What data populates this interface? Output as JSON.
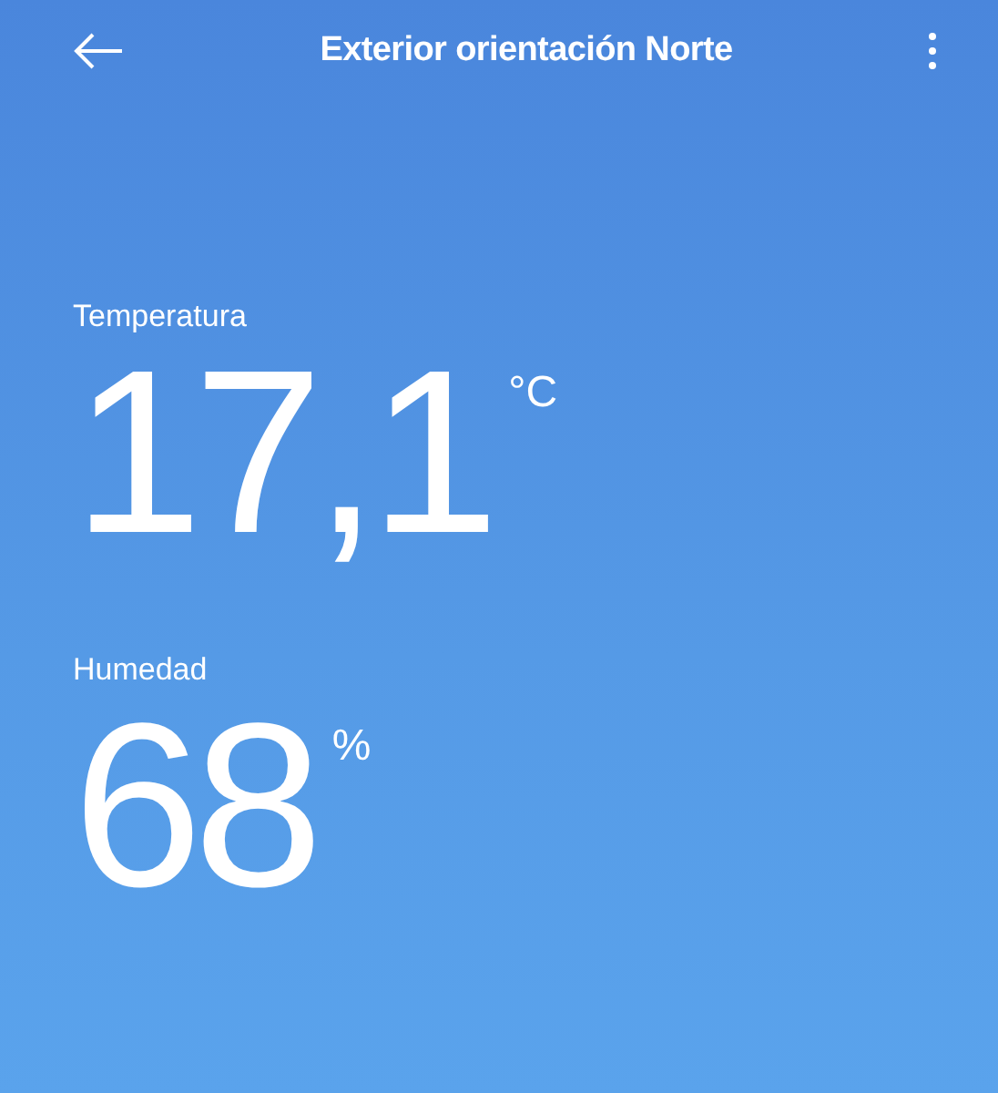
{
  "header": {
    "title": "Exterior orientación Norte"
  },
  "readings": [
    {
      "label": "Temperatura",
      "value": "17,1",
      "unit": "°C"
    },
    {
      "label": "Humedad",
      "value": "68",
      "unit": "%"
    }
  ]
}
